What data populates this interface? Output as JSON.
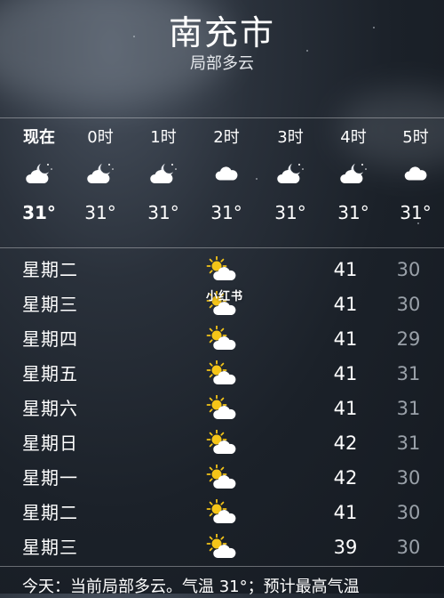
{
  "location": {
    "city": "南充市",
    "condition": "局部多云"
  },
  "hourly": [
    {
      "time": "现在",
      "icon": "partly-cloudy-night-icon",
      "temp": "31°"
    },
    {
      "time": "0时",
      "icon": "partly-cloudy-night-icon",
      "temp": "31°"
    },
    {
      "time": "1时",
      "icon": "partly-cloudy-night-icon",
      "temp": "31°"
    },
    {
      "time": "2时",
      "icon": "cloud-icon",
      "temp": "31°"
    },
    {
      "time": "3时",
      "icon": "partly-cloudy-night-icon",
      "temp": "31°"
    },
    {
      "time": "4时",
      "icon": "partly-cloudy-night-icon",
      "temp": "31°"
    },
    {
      "time": "5时",
      "icon": "cloud-icon",
      "temp": "31°"
    }
  ],
  "daily": [
    {
      "day": "星期二",
      "icon": "partly-sunny-icon",
      "high": "41",
      "low": "30"
    },
    {
      "day": "星期三",
      "icon": "partly-sunny-icon",
      "high": "41",
      "low": "30"
    },
    {
      "day": "星期四",
      "icon": "partly-sunny-icon",
      "high": "41",
      "low": "29"
    },
    {
      "day": "星期五",
      "icon": "partly-sunny-icon",
      "high": "41",
      "low": "31"
    },
    {
      "day": "星期六",
      "icon": "partly-sunny-icon",
      "high": "41",
      "low": "31"
    },
    {
      "day": "星期日",
      "icon": "partly-sunny-icon",
      "high": "42",
      "low": "31"
    },
    {
      "day": "星期一",
      "icon": "partly-sunny-icon",
      "high": "42",
      "low": "30"
    },
    {
      "day": "星期二",
      "icon": "partly-sunny-icon",
      "high": "41",
      "low": "30"
    },
    {
      "day": "星期三",
      "icon": "partly-sunny-icon",
      "high": "39",
      "low": "30"
    }
  ],
  "watermark": "小红书",
  "summary": "今天：当前局部多云。气温 31°；预计最高气温",
  "colors": {
    "background": "#1b2129",
    "low_temp": "#9aa1a9",
    "sun": "#f5c518"
  }
}
